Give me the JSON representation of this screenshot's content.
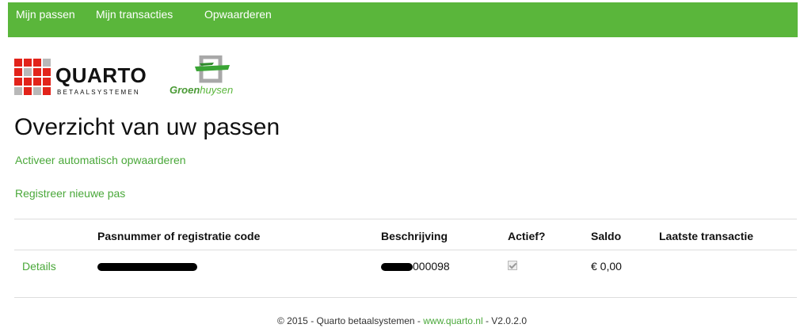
{
  "nav": {
    "items": [
      {
        "label": "Mijn passen"
      },
      {
        "label": "Mijn transacties"
      },
      {
        "label": "Opwaarderen"
      }
    ]
  },
  "logos": {
    "quarto_word": "QUARTO",
    "quarto_sub": "BETAALSYSTEMEN",
    "groenhuysen_bold": "Groen",
    "groenhuysen_light": "huysen"
  },
  "page": {
    "title": "Overzicht van uw passen",
    "activate_link": "Activeer automatisch opwaarderen",
    "register_link": "Registreer nieuwe pas"
  },
  "table": {
    "headers": [
      "Pasnummer of registratie code",
      "Beschrijving",
      "Actief?",
      "Saldo",
      "Laatste transactie"
    ],
    "rows": [
      {
        "details_label": "Details",
        "description_suffix": "000098",
        "active": true,
        "balance": "€ 0,00",
        "last_transaction": ""
      }
    ]
  },
  "footer": {
    "prefix": "© 2015 - Quarto betaalsystemen - ",
    "link": "www.quarto.nl",
    "suffix": " - V2.0.2.0"
  },
  "colors": {
    "navbar": "#5ab63b",
    "link": "#4aa83a",
    "quarto_red": "#e2231a"
  }
}
